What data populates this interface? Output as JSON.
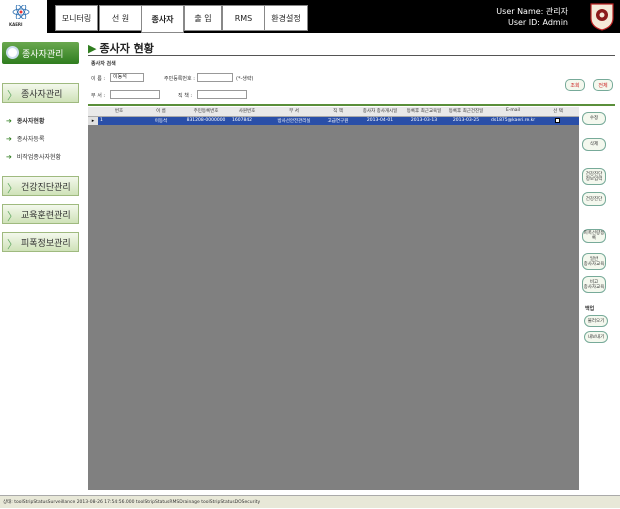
{
  "header": {
    "logo_text": "KAERI",
    "tabs": [
      {
        "label": "모니터링"
      },
      {
        "label": "선 원"
      },
      {
        "label": "종사자"
      },
      {
        "label": "출 입"
      },
      {
        "label": "RMS"
      },
      {
        "label": "환경설정"
      }
    ],
    "user_name": "User Name: 관리자",
    "user_id": "User ID: Admin"
  },
  "sidebar": {
    "header": "종사자관리",
    "sections": [
      {
        "label": "종사자관리"
      },
      {
        "label": "건강진단관리"
      },
      {
        "label": "교육훈련관리"
      },
      {
        "label": "피폭정보관리"
      }
    ],
    "items": [
      {
        "label": "종사자현황"
      },
      {
        "label": "종사자등록"
      },
      {
        "label": "비작업종사자현황"
      }
    ]
  },
  "main": {
    "title": "종사자 현황",
    "search": {
      "caption": "종사자 검색",
      "name_label": "이   름 :",
      "name_value": "이동석",
      "rrn_label": "주민등록번호 :",
      "rrn_value": "",
      "rrn_hint": "(*-생략)",
      "dept_label": "부   서 :",
      "dept_value": "",
      "position_label": "직   책 :",
      "position_value": "",
      "search_btn": "조회",
      "init_btn": "전체"
    },
    "table": {
      "columns": [
        "번호",
        "이 름",
        "주민등록번호",
        "사원번호",
        "부 서",
        "직 책",
        "종사자 종사개시일",
        "등록후 최근교육일",
        "등록후 최근건진일",
        "E-mail",
        "선 택"
      ],
      "rows": [
        {
          "marker": "▸",
          "no": "1",
          "name": "이동석",
          "rrn": "831208-0000000",
          "emp_no": "1607842",
          "dept": "방사선안전관리실",
          "position": "고급연구원",
          "start_date": "2013-04-01",
          "edu_date": "2013-03-13",
          "health_date": "2013-03-25",
          "email": "ds1875@kaeri.re.kr"
        }
      ]
    }
  },
  "right_buttons": {
    "edit": "수정",
    "delete": "삭제",
    "health_add": "건강진단\n정보입력",
    "health_mgmt": "건강진단",
    "dose_mgmt": "피폭선량등록",
    "edu_add": "일반\n종사자교육",
    "edu_special": "비고\n종사자교육",
    "backup_label": "백업",
    "import": "불러오기",
    "export": "내보내기"
  },
  "statusbar": {
    "text": "상태: toolStripStatusSurveillance 2013-08-26 17:54:56.000 toolStripStatusRMSDrainage toolStripStatusDOSecurity"
  }
}
